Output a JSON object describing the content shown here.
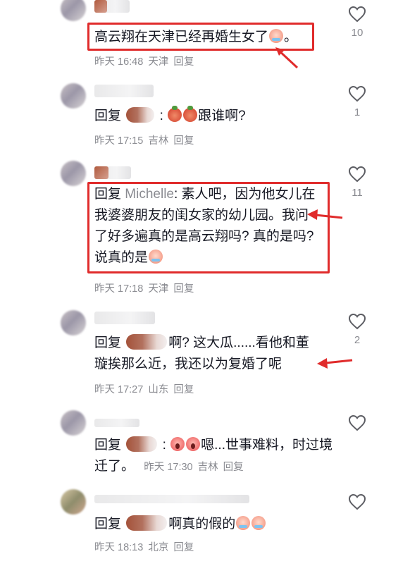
{
  "comments": [
    {
      "text": "高云翔在天津已经再婚生女了",
      "emojis": [
        "cry"
      ],
      "time": "昨天 16:48",
      "location": "天津",
      "reply_label": "回复",
      "likes": "10"
    },
    {
      "reply_prefix": "回复",
      "text": "跟谁啊?",
      "emojis": [
        "angry",
        "angry"
      ],
      "time": "昨天 17:15",
      "location": "吉林",
      "reply_label": "回复",
      "likes": "1"
    },
    {
      "reply_prefix": "回复",
      "mention": "Michelle",
      "text": ": 素人吧，因为他女儿在我婆婆朋友的闺女家的幼儿园。我问了好多遍真的是高云翔吗? 真的是吗? 说真的是",
      "emojis": [
        "cry"
      ],
      "time": "昨天 17:18",
      "location": "天津",
      "reply_label": "回复",
      "likes": "11"
    },
    {
      "reply_prefix": "回复",
      "text": "啊? 这大瓜......看他和董璇挨那么近，我还以为复婚了呢",
      "time": "昨天 17:27",
      "location": "山东",
      "reply_label": "回复",
      "likes": "2"
    },
    {
      "reply_prefix": "回复",
      "text": "嗯...世事难料，时过境迁了。",
      "emojis": [
        "scream",
        "scream"
      ],
      "time": "昨天 17:30",
      "location": "吉林",
      "reply_label": "回复",
      "likes": ""
    },
    {
      "reply_prefix": "回复",
      "text": "啊真的假的",
      "emojis": [
        "cry",
        "cry"
      ],
      "time": "昨天 18:13",
      "location": "北京",
      "reply_label": "回复",
      "likes": ""
    }
  ],
  "annotation_color": "#e02b2b",
  "icons": {
    "like": "heart-outline-icon"
  }
}
